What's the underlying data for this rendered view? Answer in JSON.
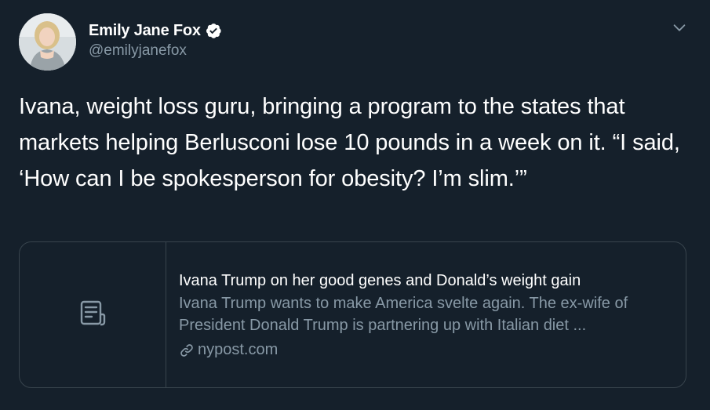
{
  "author": {
    "display_name": "Emily Jane Fox",
    "handle": "@emilyjanefox",
    "verified": true
  },
  "tweet": {
    "text": "Ivana, weight loss guru, bringing a program to the states that markets helping Berlusconi lose 10 pounds in a week on it. “I said, ‘How can I be spokesperson for obesity? I’m slim.’”"
  },
  "card": {
    "title": "Ivana Trump on her good genes and Donald’s weight gain",
    "description": "Ivana Trump wants to make America svelte again. The ex-wife of President Donald Trump is partnering up with Italian diet ...",
    "domain": "nypost.com",
    "thumbnail_icon": "document-icon"
  },
  "icons": {
    "verified": "verified-badge-icon",
    "menu": "chevron-down-icon",
    "link": "link-icon"
  },
  "colors": {
    "background": "#15202b",
    "border": "#38444d",
    "secondary_text": "#8899a6",
    "primary_text": "#ffffff"
  }
}
